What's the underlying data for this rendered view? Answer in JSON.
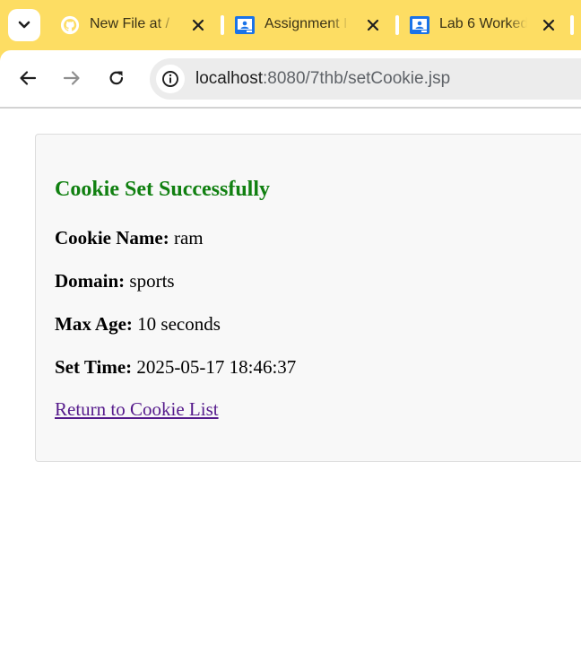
{
  "browser": {
    "tabs": [
      {
        "title": "New File at /",
        "favicon": "github-icon"
      },
      {
        "title": "Assignment I",
        "favicon": "classroom-icon"
      },
      {
        "title": "Lab 6 Worked",
        "favicon": "classroom-icon"
      }
    ],
    "url": {
      "host": "localhost",
      "path": ":8080/7thb/setCookie.jsp"
    },
    "colors": {
      "tabstrip": "#fddd63",
      "accent_green": "#118011",
      "link": "#551a8b"
    }
  },
  "page": {
    "heading": "Cookie Set Successfully",
    "fields": [
      {
        "label": "Cookie Name:",
        "value": "ram"
      },
      {
        "label": "Domain:",
        "value": "sports"
      },
      {
        "label": "Max Age:",
        "value": "10 seconds"
      },
      {
        "label": "Set Time:",
        "value": "2025-05-17 18:46:37"
      }
    ],
    "return_link": "Return to Cookie List"
  }
}
